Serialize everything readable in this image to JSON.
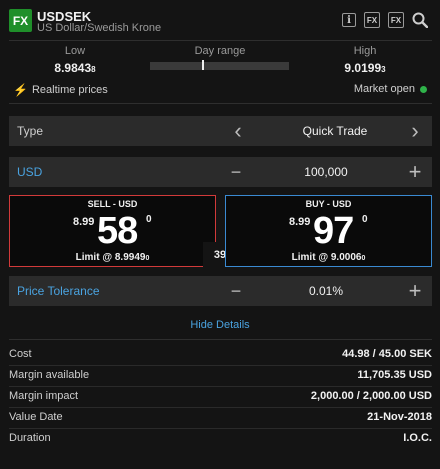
{
  "header": {
    "badge": "FX",
    "symbol": "USDSEK",
    "name": "US Dollar/Swedish Krone",
    "icons": [
      "info-icon",
      "fx-chart-icon",
      "fx-alert-icon",
      "search-icon"
    ],
    "icon_fx_1": "FX",
    "icon_fx_2": "FX",
    "icon_info": "i"
  },
  "range": {
    "low_label": "Low",
    "low_value": "8.9843",
    "low_suffix": "8",
    "day_label": "Day range",
    "high_label": "High",
    "high_value": "9.0199",
    "high_suffix": "3",
    "day_range_position": 0.38
  },
  "status": {
    "realtime": "Realtime prices",
    "market": "Market open",
    "market_color": "#2fb34a"
  },
  "type_row": {
    "label": "Type",
    "value": "Quick Trade",
    "prev": "‹",
    "next": "›"
  },
  "amount_row": {
    "label": "USD",
    "value": "100,000",
    "minus": "−",
    "plus": "+"
  },
  "sell": {
    "title": "SELL - USD",
    "pre": "8.99",
    "big": "58",
    "sup": "0",
    "limit": "Limit @ 8.9949",
    "limit_suffix": "0",
    "color": "#d23a3a"
  },
  "buy": {
    "title": "BUY - USD",
    "pre": "8.99",
    "big": "97",
    "sup": "0",
    "limit": "Limit @ 9.0006",
    "limit_suffix": "0",
    "color": "#3a8ad2"
  },
  "spread": "39",
  "tolerance_row": {
    "label": "Price Tolerance",
    "value": "0.01%",
    "minus": "−",
    "plus": "+"
  },
  "hide_details": "Hide Details",
  "details": [
    {
      "key": "Cost",
      "value": "44.98 / 45.00 SEK"
    },
    {
      "key": "Margin available",
      "value": "11,705.35 USD"
    },
    {
      "key": "Margin impact",
      "value": "2,000.00 / 2,000.00 USD"
    },
    {
      "key": "Value Date",
      "value": "21-Nov-2018"
    },
    {
      "key": "Duration",
      "value": "I.O.C."
    }
  ]
}
